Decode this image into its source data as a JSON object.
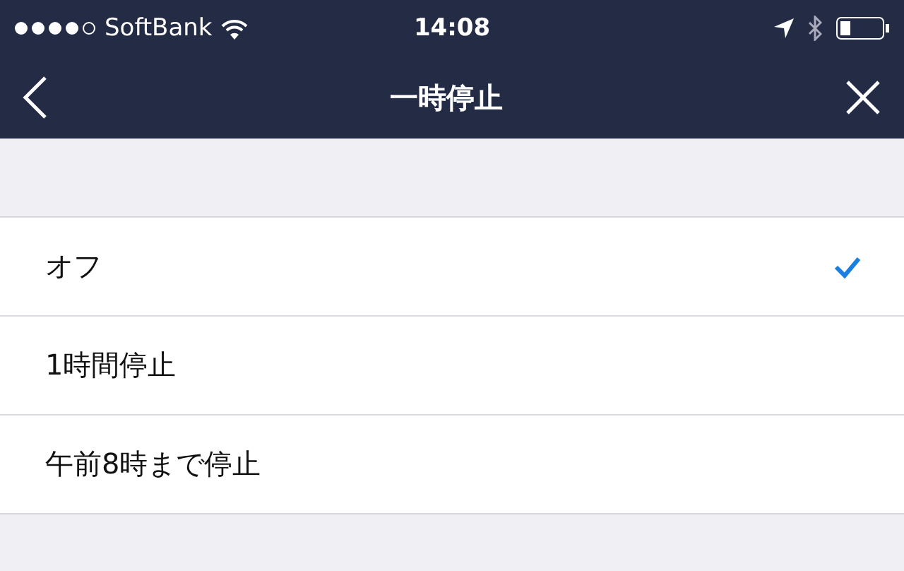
{
  "status_bar": {
    "carrier": "SoftBank",
    "time": "14:08"
  },
  "nav_bar": {
    "title": "一時停止"
  },
  "options": [
    {
      "label": "オフ",
      "selected": true
    },
    {
      "label": "1時間停止",
      "selected": false
    },
    {
      "label": "午前8時まで停止",
      "selected": false
    }
  ]
}
